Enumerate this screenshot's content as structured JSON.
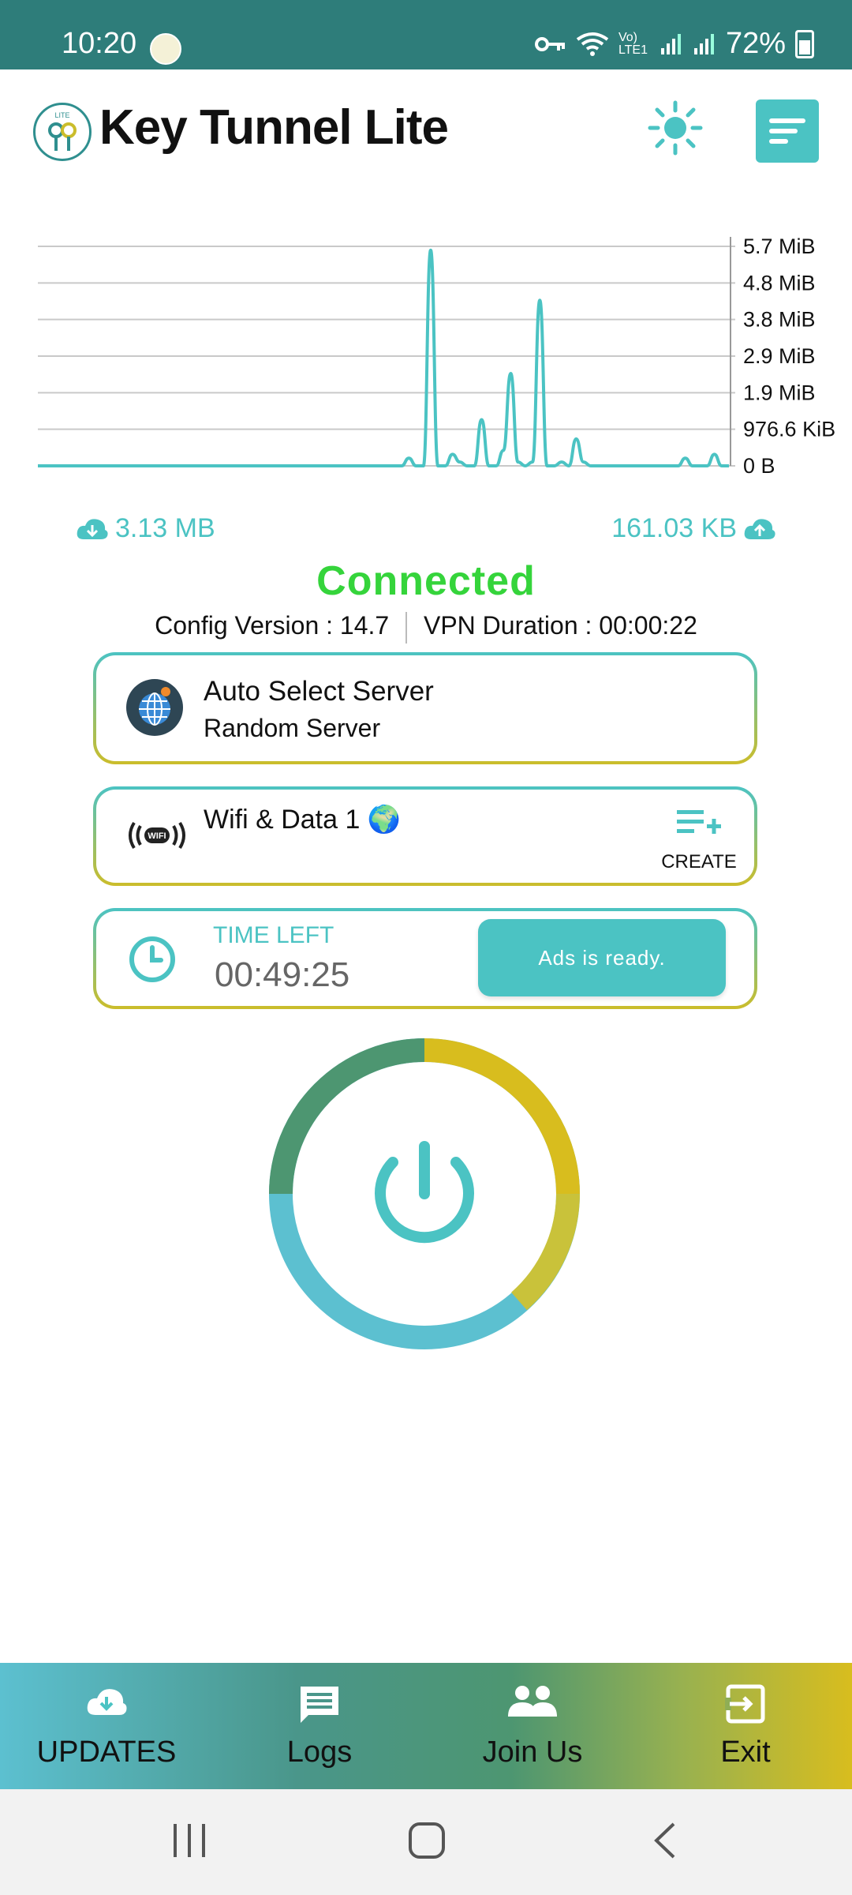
{
  "status_bar": {
    "time": "10:20",
    "battery": "72%",
    "network": "Vo) LTE1"
  },
  "header": {
    "title": "Key Tunnel Lite",
    "logo_text": "LITE"
  },
  "chart_data": {
    "type": "line",
    "title": "",
    "xlabel": "",
    "ylabel": "",
    "y_tick_labels": [
      "5.7 MiB",
      "4.8 MiB",
      "3.8 MiB",
      "2.9 MiB",
      "1.9 MiB",
      "976.6 KiB",
      "0 B"
    ],
    "series": [
      {
        "values": [
          0,
          0,
          0,
          0,
          0,
          0,
          0,
          0,
          0,
          0,
          0,
          0,
          0,
          0,
          0,
          0,
          0,
          0,
          0,
          0,
          0,
          0,
          0,
          0,
          0,
          0,
          0,
          0,
          0,
          0,
          0,
          0,
          0,
          0,
          0,
          0,
          0,
          0,
          0,
          0,
          0,
          0,
          0,
          0,
          0,
          0,
          0,
          0,
          0,
          0,
          0,
          0.2,
          0,
          0,
          5.6,
          0,
          0,
          0.3,
          0.1,
          0,
          0,
          1.2,
          0,
          0,
          0.4,
          2.4,
          0.1,
          0,
          0.1,
          4.3,
          0,
          0,
          0.1,
          0,
          0.7,
          0.1,
          0,
          0,
          0,
          0,
          0,
          0,
          0,
          0,
          0,
          0,
          0,
          0,
          0,
          0.2,
          0,
          0,
          0,
          0.3,
          0,
          0
        ]
      }
    ],
    "ylim": [
      0,
      5.7
    ],
    "grid": true
  },
  "stats": {
    "download": "3.13 MB",
    "upload": "161.03 KB"
  },
  "connection": {
    "status": "Connected",
    "config_version": "Config Version : 14.7",
    "vpn_duration": "VPN Duration : 00:00:22"
  },
  "server": {
    "title": "Auto Select Server",
    "subtitle": "Random Server"
  },
  "network": {
    "title": "Wifi & Data 1 🌍",
    "create_label": "CREATE",
    "wifi_badge": "WIFI"
  },
  "timer": {
    "label": "TIME LEFT",
    "value": "00:49:25",
    "ads_label": "Ads is ready."
  },
  "bottom_nav": {
    "updates": "UPDATES",
    "logs": "Logs",
    "join": "Join Us",
    "exit": "Exit"
  },
  "colors": {
    "accent": "#4bc3c3",
    "connected": "#35d43b",
    "status_bar": "#2e7d7a"
  }
}
